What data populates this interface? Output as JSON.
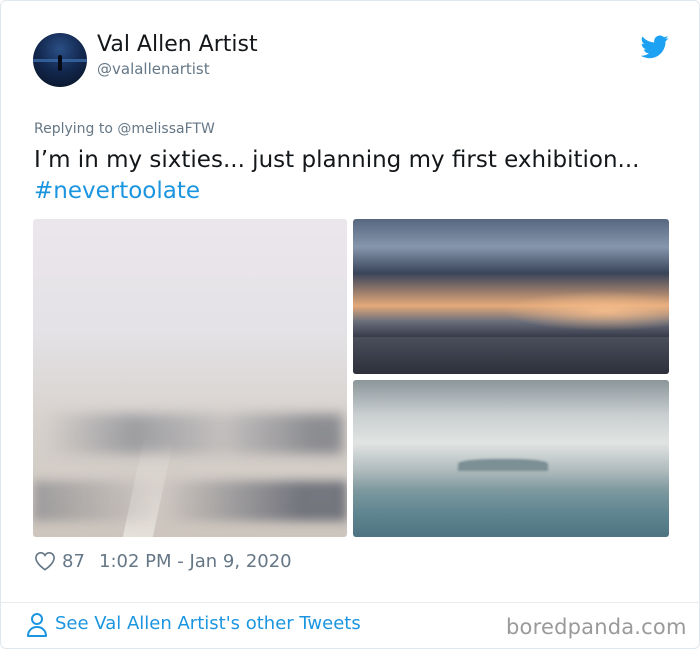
{
  "author": {
    "name": "Val Allen Artist",
    "handle": "@valallenartist",
    "avatar_icon": "painting-avatar"
  },
  "header": {
    "platform_icon": "twitter-bird-icon",
    "platform_color": "#1da1f2"
  },
  "tweet": {
    "replying_prefix": "Replying to",
    "replying_to": "@melissaFTW",
    "text": "I’m in my sixties... just planning my first exhibition...",
    "hashtag": "#nevertoolate",
    "media": [
      {
        "label": "foggy landscape painting"
      },
      {
        "label": "sunset sky over sea painting"
      },
      {
        "label": "misty seascape painting"
      }
    ]
  },
  "stats": {
    "like_icon": "heart-icon",
    "likes": "87",
    "timestamp": "1:02 PM - Jan 9, 2020"
  },
  "footer": {
    "person_icon": "person-icon",
    "see_more": "See Val Allen Artist's other Tweets",
    "watermark": "boredpanda.com"
  },
  "colors": {
    "link": "#1b95e0",
    "text": "#14171a",
    "muted": "#657786"
  }
}
